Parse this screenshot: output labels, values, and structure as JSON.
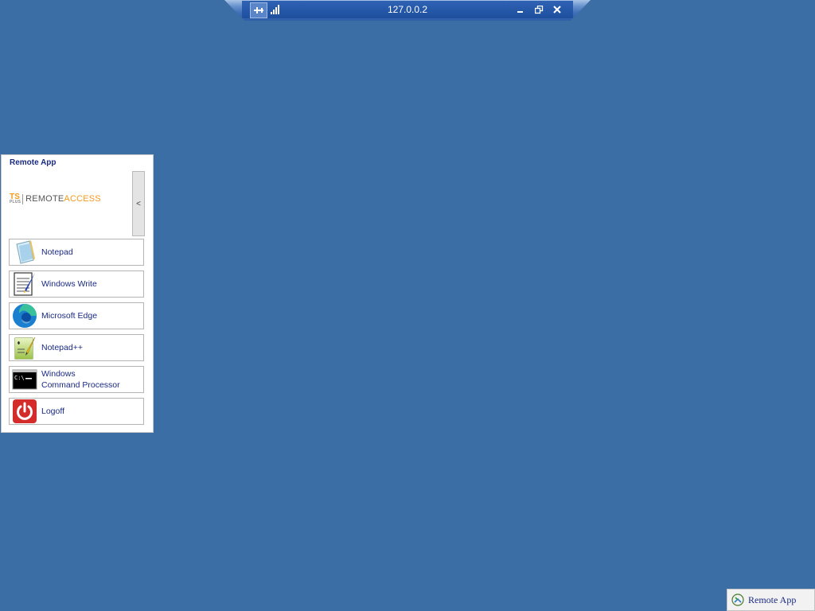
{
  "connection_bar": {
    "title": "127.0.0.2",
    "pin_icon": "pin-icon",
    "signal_icon": "signal-strength-icon",
    "minimize_icon": "minimize-icon",
    "restore_icon": "restore-icon",
    "close_icon": "close-icon"
  },
  "panel": {
    "title": "Remote App",
    "logo": {
      "ts": "TS",
      "plus": "PLUS",
      "remote": "REMOTE",
      "access": "ACCESS"
    },
    "collapse_label": "<",
    "apps": [
      {
        "label": "Notepad",
        "icon": "notepad-icon"
      },
      {
        "label": "Windows Write",
        "icon": "wordpad-icon"
      },
      {
        "label": "Microsoft Edge",
        "icon": "edge-icon"
      },
      {
        "label": "Notepad++",
        "icon": "notepadpp-icon"
      },
      {
        "label": "Windows",
        "label2": "Command Processor",
        "icon": "cmd-icon"
      },
      {
        "label": "Logoff",
        "icon": "power-icon"
      }
    ]
  },
  "taskbar": {
    "label": "Remote App",
    "icon": "remote-app-icon"
  },
  "colors": {
    "desktop": "#3b6ea5",
    "text_accent": "#1a2a80",
    "brand_orange": "#f29a1d"
  }
}
